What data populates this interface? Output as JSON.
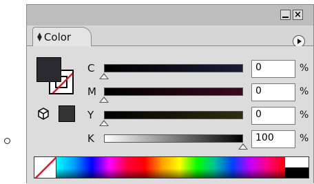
{
  "panel": {
    "tab_label": "Color"
  },
  "rows": [
    {
      "label": "C",
      "value": "0",
      "unit": "%",
      "gradient_from": "#000000",
      "gradient_to": "#1b1b3a",
      "level": 0
    },
    {
      "label": "M",
      "value": "0",
      "unit": "%",
      "gradient_from": "#000000",
      "gradient_to": "#3a0a1e",
      "level": 0
    },
    {
      "label": "Y",
      "value": "0",
      "unit": "%",
      "gradient_from": "#000000",
      "gradient_to": "#2e2e10",
      "level": 0
    },
    {
      "label": "K",
      "value": "100",
      "unit": "%",
      "gradient_from": "#ffffff",
      "gradient_to": "#000000",
      "level": 100
    }
  ],
  "colors": {
    "fill": "#2a2a30",
    "none_slash": "#e0182a"
  },
  "icons": {
    "minimize": "minimize-icon",
    "close": "close-icon",
    "panel_menu": "panel-menu-icon",
    "out_of_web": "cube-icon"
  }
}
